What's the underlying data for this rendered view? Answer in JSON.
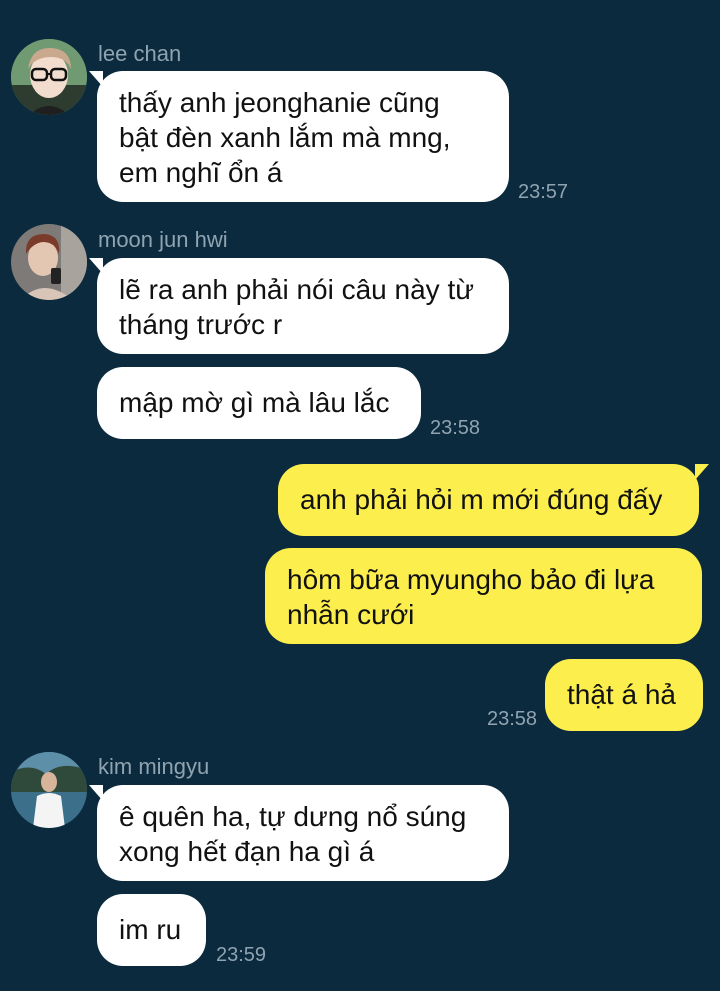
{
  "colors": {
    "background": "#0c2a3d",
    "incoming_bubble": "#ffffff",
    "outgoing_bubble": "#fcee4c",
    "meta_text": "#8fa3b0"
  },
  "groups": [
    {
      "sender": "lee chan",
      "avatar_icon": "avatar-lee-chan",
      "messages": [
        {
          "lines": [
            "thấy anh jeonghanie cũng",
            "bật đèn xanh lắm mà mng,",
            "em nghĩ ổn á"
          ]
        }
      ],
      "time": "23:57"
    },
    {
      "sender": "moon jun hwi",
      "avatar_icon": "avatar-moon-jun-hwi",
      "messages": [
        {
          "lines": [
            "lẽ ra anh phải nói câu này từ",
            "tháng trước r"
          ]
        },
        {
          "lines": [
            "mập mờ gì mà lâu lắc"
          ]
        }
      ],
      "time": "23:58"
    },
    {
      "sender": "",
      "outgoing": true,
      "messages": [
        {
          "lines": [
            "anh phải hỏi m mới đúng đấy"
          ]
        },
        {
          "lines": [
            "hôm bữa myungho bảo đi lựa",
            "nhẫn cưới"
          ]
        },
        {
          "lines": [
            "thật á hả"
          ]
        }
      ],
      "time": "23:58"
    },
    {
      "sender": "kim mingyu",
      "avatar_icon": "avatar-kim-mingyu",
      "messages": [
        {
          "lines": [
            "ê quên ha, tự dưng nổ súng",
            "xong hết đạn ha gì á"
          ]
        },
        {
          "lines": [
            "im ru"
          ]
        }
      ],
      "time": "23:59"
    }
  ]
}
